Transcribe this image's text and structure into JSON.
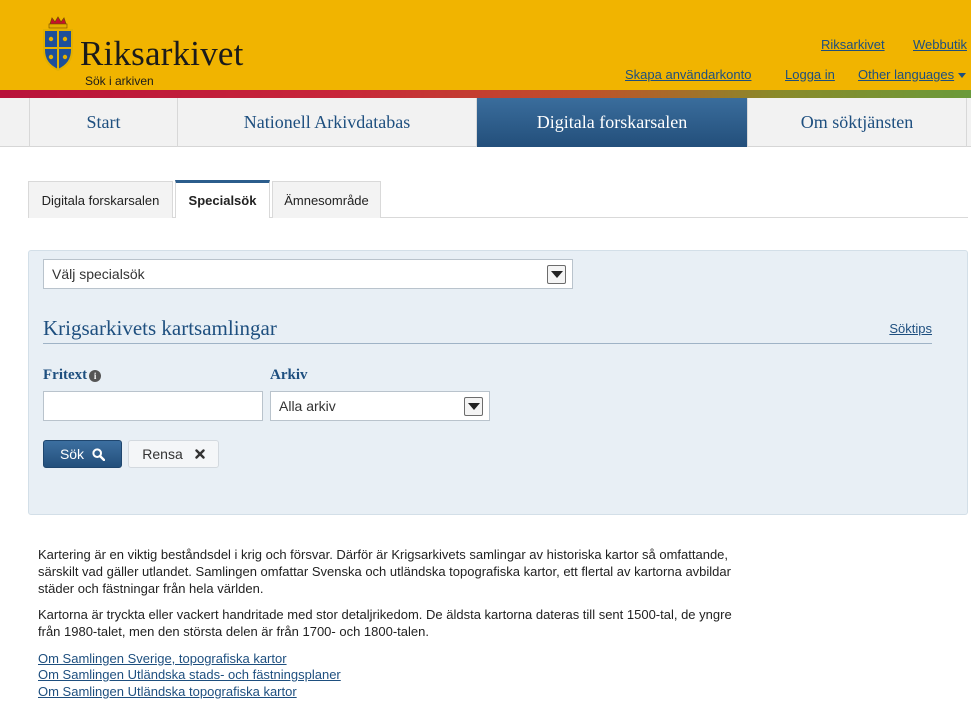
{
  "header": {
    "logo_title": "Riksarkivet",
    "logo_subtitle": "Sök i arkiven",
    "top_links": [
      "Riksarkivet",
      "Webbutik"
    ],
    "account_links": [
      "Skapa användarkonto",
      "Logga in"
    ],
    "language_link": "Other languages",
    "brand_color": "#f1b400"
  },
  "main_nav": {
    "items": [
      "Start",
      "Nationell Arkivdatabas",
      "Digitala forskarsalen",
      "Om söktjänsten"
    ],
    "active": "Digitala forskarsalen"
  },
  "sub_tabs": {
    "items": [
      "Digitala forskarsalen",
      "Specialsök",
      "Ämnesområde"
    ],
    "active": "Specialsök"
  },
  "search": {
    "special_select_value": "Välj specialsök",
    "section_title": "Krigsarkivets kartsamlingar",
    "help_link": "Söktips",
    "fritext_label": "Fritext",
    "fritext_value": "",
    "arkiv_label": "Arkiv",
    "arkiv_value": "Alla arkiv",
    "search_button": "Sök",
    "clear_button": "Rensa"
  },
  "content": {
    "paragraphs": [
      "Kartering är en viktig beståndsdel i krig och försvar. Därför är Krigsarkivets samlingar av historiska kartor så omfattande, särskilt vad gäller utlandet. Samlingen omfattar Svenska och utländska topografiska kartor, ett flertal av kartorna avbildar städer och fästningar från hela världen.",
      "Kartorna är tryckta eller vackert handritade med stor detaljrikedom. De äldsta kartorna dateras till sent 1500-tal, de yngre från 1980-talet, men den största delen är från 1700- och 1800-talen."
    ],
    "links": [
      "Om Samlingen Sverige, topografiska kartor",
      "Om Samlingen Utländska stads- och fästningsplaner",
      "Om Samlingen Utländska topografiska kartor"
    ]
  }
}
